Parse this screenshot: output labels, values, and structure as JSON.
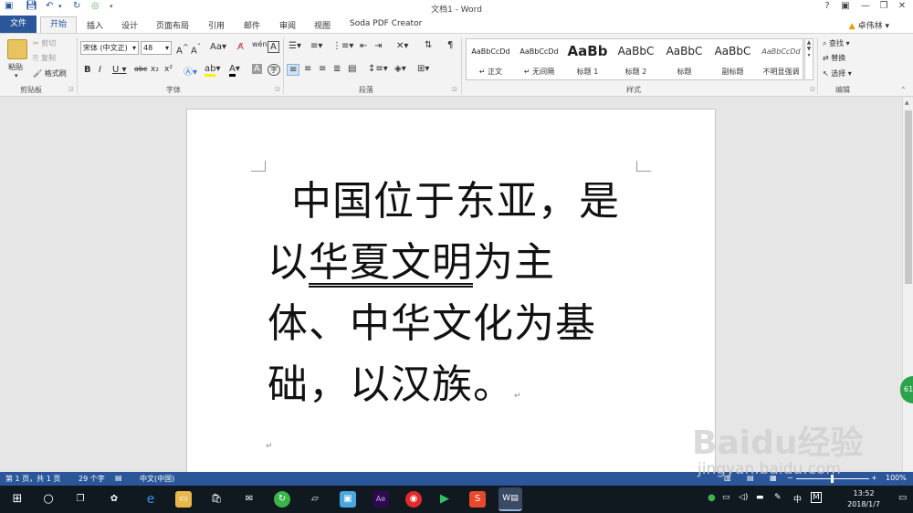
{
  "window": {
    "title": "文档1 - Word",
    "help": "?",
    "user_name": "卓伟林"
  },
  "tabs": {
    "file": "文件",
    "home": "开始",
    "insert": "插入",
    "design": "设计",
    "layout": "页面布局",
    "references": "引用",
    "mailings": "邮件",
    "review": "审阅",
    "view": "视图",
    "soda": "Soda PDF Creator"
  },
  "clipboard": {
    "paste": "粘贴",
    "cut": "剪切",
    "copy": "复制",
    "format_painter": "格式刷",
    "label": "剪贴板"
  },
  "font": {
    "name": "宋体 (中文正)",
    "size": "48",
    "label": "字体"
  },
  "paragraph": {
    "label": "段落"
  },
  "styles": {
    "label": "样式",
    "items": [
      {
        "sample": "AaBbCcDd",
        "name": "↵ 正文"
      },
      {
        "sample": "AaBbCcDd",
        "name": "↵ 无间隔"
      },
      {
        "sample": "AaBb",
        "name": "标题 1"
      },
      {
        "sample": "AaBbC",
        "name": "标题 2"
      },
      {
        "sample": "AaBbC",
        "name": "标题"
      },
      {
        "sample": "AaBbC",
        "name": "副标题"
      },
      {
        "sample": "AaBbCcDd",
        "name": "不明显强调"
      }
    ]
  },
  "editing": {
    "find": "查找",
    "replace": "替换",
    "select": "选择",
    "label": "编辑"
  },
  "document": {
    "line1": "中国位于东亚，是",
    "line2_pre": "以",
    "line2_underlined": "华夏文明",
    "line2_post": "为主",
    "line3": "体、中华文化为基",
    "line4": "础，以汉族。",
    "para_mark": "↵"
  },
  "status": {
    "page": "第 1 页，共 1 页",
    "words": "29 个字",
    "language": "中文(中国)",
    "zoom": "100%"
  },
  "taskbar": {
    "ime": "中",
    "time": "13:52",
    "date": "2018/1/7"
  },
  "side_badge": "61",
  "watermark": {
    "logo": "Baidu经验",
    "url": "jingyan.baidu.com"
  },
  "colors": {
    "word_blue": "#2b579a",
    "taskbar": "#101820"
  }
}
